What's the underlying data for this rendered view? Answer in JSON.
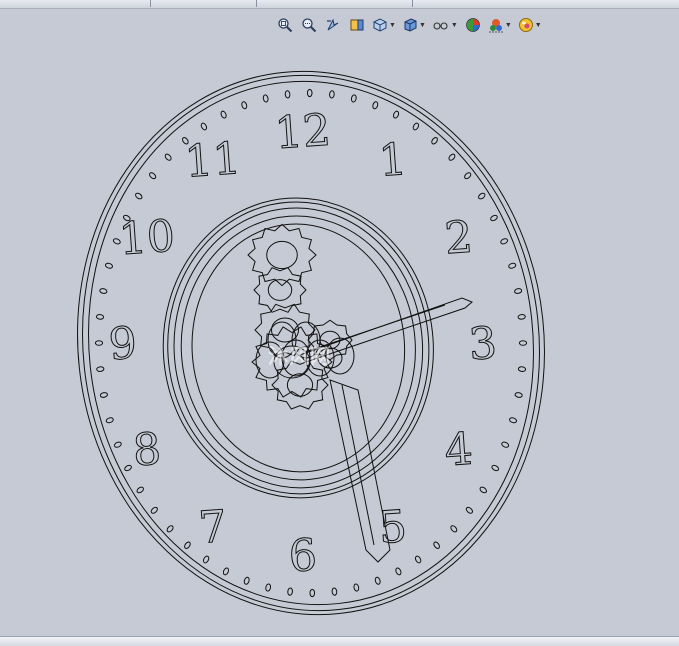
{
  "toolbar": {
    "buttons": [
      {
        "id": "zoom-to-fit",
        "icon": "zoom-to-fit-icon",
        "dropdown": false
      },
      {
        "id": "zoom-to-area",
        "icon": "zoom-to-area-icon",
        "dropdown": false
      },
      {
        "id": "previous-view",
        "icon": "previous-view-icon",
        "dropdown": false
      },
      {
        "id": "section-view",
        "icon": "section-view-icon",
        "dropdown": false
      },
      {
        "id": "view-orientation",
        "icon": "view-orientation-icon",
        "dropdown": true
      },
      {
        "id": "display-style",
        "icon": "display-style-icon",
        "dropdown": true
      },
      {
        "id": "hide-show-items",
        "icon": "hide-show-items-icon",
        "dropdown": true
      },
      {
        "id": "edit-appearance",
        "icon": "edit-appearance-icon",
        "dropdown": false
      },
      {
        "id": "apply-scene",
        "icon": "apply-scene-icon",
        "dropdown": true
      },
      {
        "id": "view-settings",
        "icon": "view-settings-icon",
        "dropdown": true
      }
    ]
  },
  "clock": {
    "numerals": [
      "12",
      "1",
      "2",
      "3",
      "4",
      "5",
      "6",
      "7",
      "8",
      "9",
      "10",
      "11"
    ],
    "minute_marks": 60
  },
  "watermark": {
    "text": "沐风网"
  },
  "colors": {
    "background": "#c6cad4",
    "wireframe": "#111111"
  }
}
